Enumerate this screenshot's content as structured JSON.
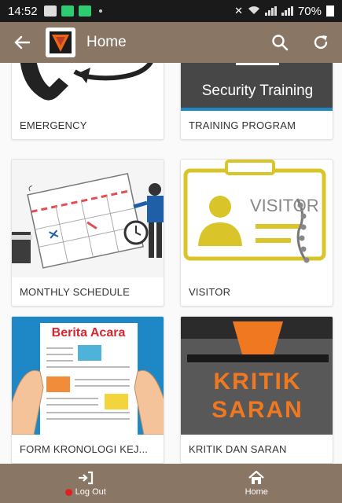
{
  "status_bar": {
    "time": "14:52",
    "battery": "70%"
  },
  "app_bar": {
    "title": "Home"
  },
  "cards": [
    {
      "label": "EMERGENCY"
    },
    {
      "label": "TRAINING PROGRAM",
      "image_text": "Security Training"
    },
    {
      "label": "MONTHLY SCHEDULE"
    },
    {
      "label": "VISITOR",
      "image_text": "VISITOR"
    },
    {
      "label": "FORM KRONOLOGI KEJ...",
      "image_text": "Berita Acara"
    },
    {
      "label": "KRITIK DAN SARAN",
      "image_text_1": "KRITIK",
      "image_text_2": "SARAN"
    }
  ],
  "bottom_nav": {
    "logout_label": "Log Out",
    "home_label": "Home"
  },
  "colors": {
    "bar": "#8a7665",
    "status": "#1a1a1a",
    "accent_blue": "#1e88c7"
  }
}
